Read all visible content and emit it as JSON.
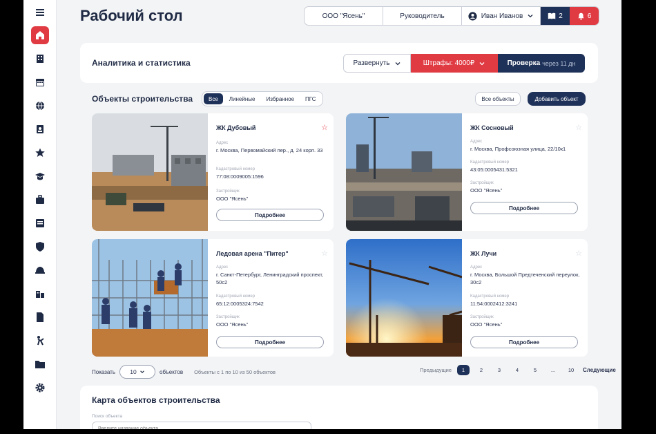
{
  "page": {
    "title": "Рабочий стол"
  },
  "topbar": {
    "organization": "ООО \"Ясень\"",
    "role": "Руководитель",
    "user_name": "Иван Иванов",
    "docs_count": "2",
    "alerts_count": "6"
  },
  "sidebar": {
    "items": [
      "menu-icon",
      "home-icon",
      "building-icon",
      "calendar-icon",
      "globe-icon",
      "id-card-icon",
      "star-icon",
      "graduation-icon",
      "briefcase-icon",
      "document-list-icon",
      "shield-icon",
      "helmet-icon",
      "city-icon",
      "file-icon",
      "worker-icon",
      "folder-icon",
      "gear-icon"
    ],
    "active": "home-icon"
  },
  "analytics": {
    "title": "Аналитика и статистика",
    "expand_label": "Развернуть",
    "fines_label": "Штрафы: 4000₽",
    "check_label": "Проверка",
    "check_sub": "через 11 дн"
  },
  "objects": {
    "title": "Объекты строительства",
    "filters": [
      "Все",
      "Линейные",
      "Избранное",
      "ПГС"
    ],
    "active_filter": "Все",
    "all_button": "Все объекты",
    "add_button": "Добавить объект",
    "address_label": "Адрес",
    "cadastral_label": "Кадастровый номер",
    "developer_label": "Застройщик",
    "more_label": "Подробнее",
    "items": [
      {
        "name": "ЖК Дубовый",
        "address": "г. Москва, Первомайский пер., д. 24 корп. 33",
        "cadastral": "77:08:0009005:1596",
        "developer": "ООО \"Ясень\"",
        "favorite": true
      },
      {
        "name": "ЖК Сосновый",
        "address": "г. Москва, Профсоюзная улица, 22/10к1",
        "cadastral": "43:05:0005431:5321",
        "developer": "ООО \"Ясень\"",
        "favorite": false
      },
      {
        "name": "Ледовая арена \"Питер\"",
        "address": "г. Санкт-Петербург, Ленинградский проспект, 50с2",
        "cadastral": "65:12:0005324:7542",
        "developer": "ООО \"Ясень\"",
        "favorite": false
      },
      {
        "name": "ЖК Лучи",
        "address": "г. Москва, Большой Предтеченский переулок, 30с2",
        "cadastral": "11:54:0002412:3241",
        "developer": "ООО \"Ясень\"",
        "favorite": false
      }
    ]
  },
  "pagination": {
    "show_label": "Показать",
    "per_page": "10",
    "objects_label": "объектов",
    "range_info": "Объекты с 1 по 10 из 50 объектов",
    "prev_label": "Предыдущие",
    "next_label": "Следующие",
    "pages": [
      "1",
      "2",
      "3",
      "4",
      "5",
      "...",
      "10"
    ],
    "current_page": "1"
  },
  "map": {
    "title": "Карта объектов строительства",
    "search_label": "Поиск объекта",
    "search_placeholder": "Введите название объекта"
  },
  "colors": {
    "accent_red": "#e03a43",
    "navy": "#1e3158",
    "background": "#f3f4f6"
  }
}
